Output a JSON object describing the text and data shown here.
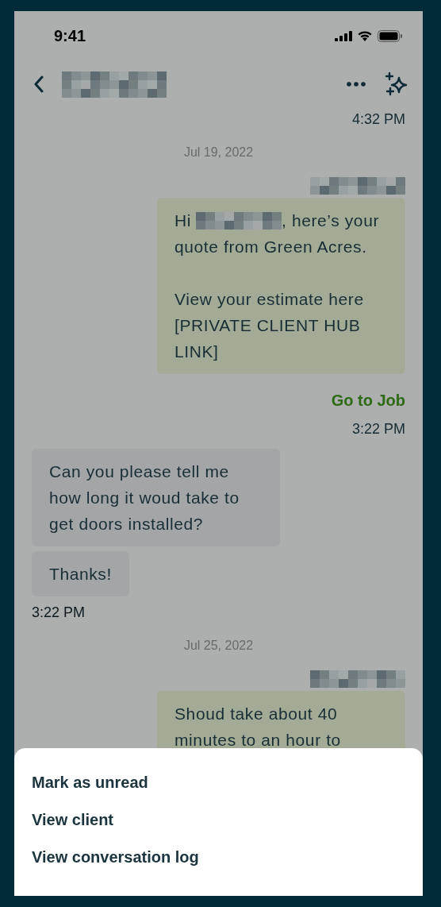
{
  "status_bar": {
    "time": "9:41"
  },
  "thread": [
    {
      "kind": "time",
      "outgoing": true,
      "text": "4:32 PM"
    },
    {
      "kind": "date",
      "text": "Jul 19, 2022"
    },
    {
      "kind": "sender",
      "outgoing": true
    },
    {
      "kind": "bubble",
      "outgoing": true,
      "paragraphs": [
        [
          [
            {
              "kind": "text",
              "text": "Hi"
            },
            {
              "kind": "redacted"
            },
            {
              "kind": "text",
              "text": ", here’s your"
            }
          ],
          [
            {
              "kind": "text",
              "text": "quote from Green Acres."
            }
          ]
        ],
        [
          [
            {
              "kind": "text",
              "text": "View your estimate here [PRIVATE CLIENT HUB LINK]"
            }
          ]
        ]
      ]
    },
    {
      "kind": "link",
      "outgoing": true,
      "text": "Go to Job"
    },
    {
      "kind": "time",
      "outgoing": true,
      "text": "3:22 PM"
    },
    {
      "kind": "bubble",
      "outgoing": false,
      "paragraphs": [
        [
          [
            {
              "kind": "text",
              "text": "Can you please tell me how long it woud take to get doors installed?"
            }
          ]
        ]
      ]
    },
    {
      "kind": "bubble",
      "outgoing": false,
      "paragraphs": [
        [
          [
            {
              "kind": "text",
              "text": "Thanks!"
            }
          ]
        ]
      ]
    },
    {
      "kind": "time",
      "outgoing": false,
      "text": "3:22 PM"
    },
    {
      "kind": "date",
      "text": "Jul 25, 2022"
    },
    {
      "kind": "sender",
      "outgoing": true
    },
    {
      "kind": "bubble",
      "outgoing": true,
      "paragraphs": [
        [
          [
            {
              "kind": "text",
              "text": "Shoud take about 40 minutes to an hour to"
            }
          ]
        ]
      ]
    }
  ],
  "action_sheet": {
    "items": [
      "Mark as unread",
      "View client",
      "View conversation log"
    ]
  }
}
